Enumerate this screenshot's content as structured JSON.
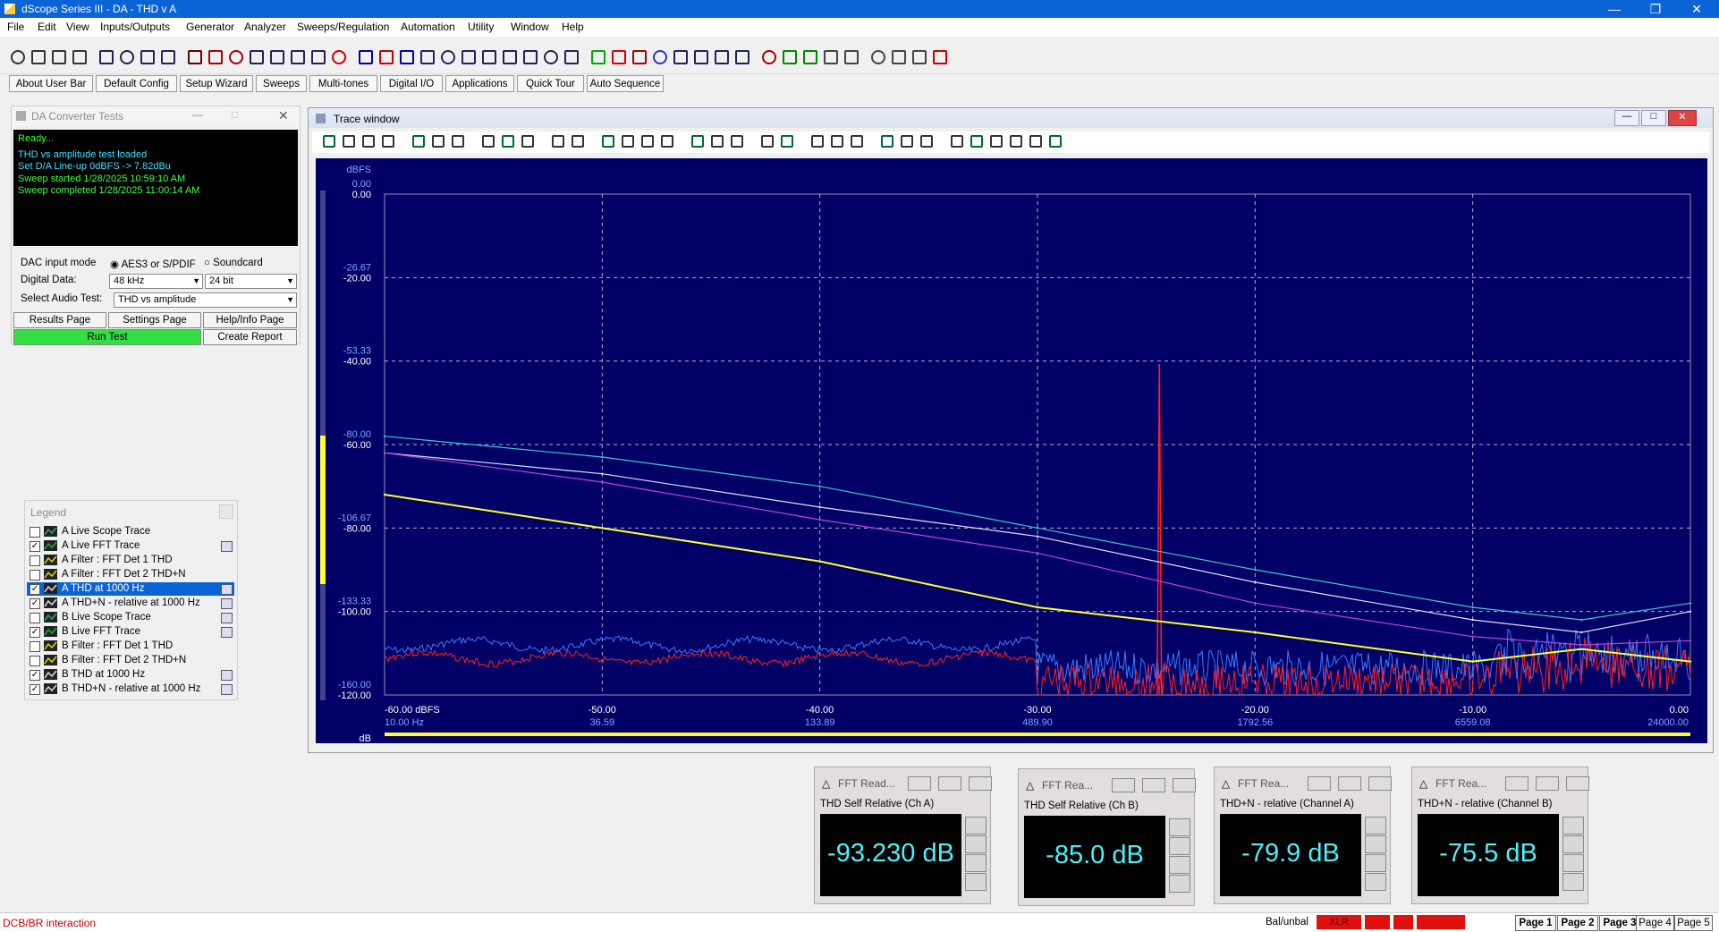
{
  "app": {
    "title": "dScope Series III - DA - THD v A"
  },
  "menu": [
    "File",
    "Edit",
    "View",
    "Inputs/Outputs",
    "Generator",
    "Analyzer",
    "Sweeps/Regulation",
    "Automation",
    "Utility",
    "Window",
    "Help"
  ],
  "userbar": [
    "About User Bar",
    "Default Config",
    "Setup Wizard",
    "Sweeps",
    "Multi-tones",
    "Digital I/O",
    "Applications",
    "Quick Tour",
    "Auto Sequence"
  ],
  "da_panel": {
    "title": "DA Converter Tests",
    "log": [
      "Ready...",
      "THD vs amplitude test loaded",
      "Set D/A Line-up 0dBFS -> 7.82dBu",
      "Sweep started 1/28/2025 10:59:10 AM",
      "Sweep completed 1/28/2025 11:00:14 AM"
    ],
    "log_colors": [
      "#40ff40",
      "#40e0ff",
      "#40e0ff",
      "#40ff40",
      "#40ff40"
    ],
    "dac_input_mode_label": "DAC input mode",
    "radio_aes": "AES3 or S/PDIF",
    "radio_sound": "Soundcard",
    "digital_data_label": "Digital Data:",
    "rate": "48 kHz",
    "bits": "24 bit",
    "select_test_label": "Select Audio Test:",
    "test": "THD vs amplitude",
    "results_btn": "Results Page",
    "settings_btn": "Settings Page",
    "help_btn": "Help/Info Page",
    "run_btn": "Run Test",
    "report_btn": "Create Report"
  },
  "legend": {
    "title": "Legend",
    "items": [
      {
        "label": "A  Live Scope Trace",
        "checked": false
      },
      {
        "label": "A  Live FFT Trace",
        "checked": true
      },
      {
        "label": "A  Filter : FFT Det 1 THD",
        "checked": false
      },
      {
        "label": "A  Filter : FFT Det 2 THD+N",
        "checked": false
      },
      {
        "label": "A  THD  at 1000 Hz",
        "checked": true
      },
      {
        "label": "A  THD+N - relative  at 1000 Hz",
        "checked": true
      },
      {
        "label": "B  Live Scope Trace",
        "checked": false
      },
      {
        "label": "B  Live FFT Trace",
        "checked": true
      },
      {
        "label": "B  Filter : FFT Det 1 THD",
        "checked": false
      },
      {
        "label": "B  Filter : FFT Det 2 THD+N",
        "checked": false
      },
      {
        "label": "B  THD  at 1000 Hz",
        "checked": true
      },
      {
        "label": "B  THD+N - relative  at 1000 Hz",
        "checked": true
      }
    ]
  },
  "trace": {
    "title": "Trace window",
    "y_unit_top": "dBFS",
    "y_unit_bottom": "dB",
    "y_left_ticks": [
      "0.00",
      "-20.00",
      "-40.00",
      "-60.00",
      "-80.00",
      "-100.00",
      "-120.00"
    ],
    "y_right_ticks": [
      "0.00",
      "-26.67",
      "-53.33",
      "-80.00",
      "-106.67",
      "-133.33",
      "-160.00"
    ],
    "x_ticks": [
      "-60.00 dBFS",
      "-50.00",
      "-40.00",
      "-30.00",
      "-20.00",
      "-10.00",
      "0.00"
    ],
    "x_freq_ticks": [
      "10.00 Hz",
      "36.59",
      "133.89",
      "489.90",
      "1792.56",
      "6559.08",
      "24000.00"
    ]
  },
  "chart_data": {
    "type": "line",
    "xlabel": "",
    "ylabel": "",
    "xlim": [
      -60,
      0
    ],
    "ylim": [
      -120,
      0
    ],
    "grid": true,
    "series": [
      {
        "name": "A  THD+N - relative  at 1000 Hz",
        "color": "#40c8c8",
        "x": [
          -60,
          -50,
          -40,
          -30,
          -20,
          -10,
          -5,
          0
        ],
        "y": [
          -58,
          -63,
          -70,
          -80,
          -90,
          -99,
          -102,
          -98
        ]
      },
      {
        "name": "B  THD+N - relative  at 1000 Hz",
        "color": "#e0e0f0",
        "x": [
          -60,
          -50,
          -40,
          -30,
          -20,
          -10,
          -5,
          0
        ],
        "y": [
          -62,
          -67,
          -75,
          -82,
          -93,
          -102,
          -105,
          -100
        ]
      },
      {
        "name": "A  THD  at 1000 Hz",
        "color": "#c040e0",
        "x": [
          -60,
          -50,
          -40,
          -30,
          -20,
          -10,
          -5,
          0
        ],
        "y": [
          -62,
          -69,
          -78,
          -86,
          -98,
          -106,
          -108,
          -107
        ]
      },
      {
        "name": "B  THD  at 1000 Hz",
        "color": "#ffff30",
        "x": [
          -60,
          -50,
          -40,
          -30,
          -20,
          -10,
          -5,
          0
        ],
        "y": [
          -72,
          -80,
          -88,
          -99,
          -105,
          -112,
          -109,
          -112
        ]
      }
    ]
  },
  "fft_readers": [
    {
      "title": "FFT Read...",
      "label": "THD Self Relative (Ch A)",
      "value": "-93.230 dB"
    },
    {
      "title": "FFT Rea...",
      "label": "THD Self Relative (Ch B)",
      "value": "-85.0 dB"
    },
    {
      "title": "FFT Rea...",
      "label": "THD+N - relative (Channel A)",
      "value": "-79.9 dB"
    },
    {
      "title": "FFT Rea...",
      "label": "THD+N - relative (Channel B)",
      "value": "-75.5 dB"
    }
  ],
  "status": {
    "text": "DCB/BR interaction",
    "bal": "Bal/unbal",
    "xlr": "XLR",
    "pages": [
      "Page 1",
      "Page 2",
      "Page 3",
      "Page 4",
      "Page 5"
    ]
  },
  "colors": {
    "accent": "#0a64d6",
    "plot_bg": "#000066",
    "grid": "#a0a0c0",
    "axis_text": "#ffffff",
    "freq_text": "#7aa8ff"
  }
}
